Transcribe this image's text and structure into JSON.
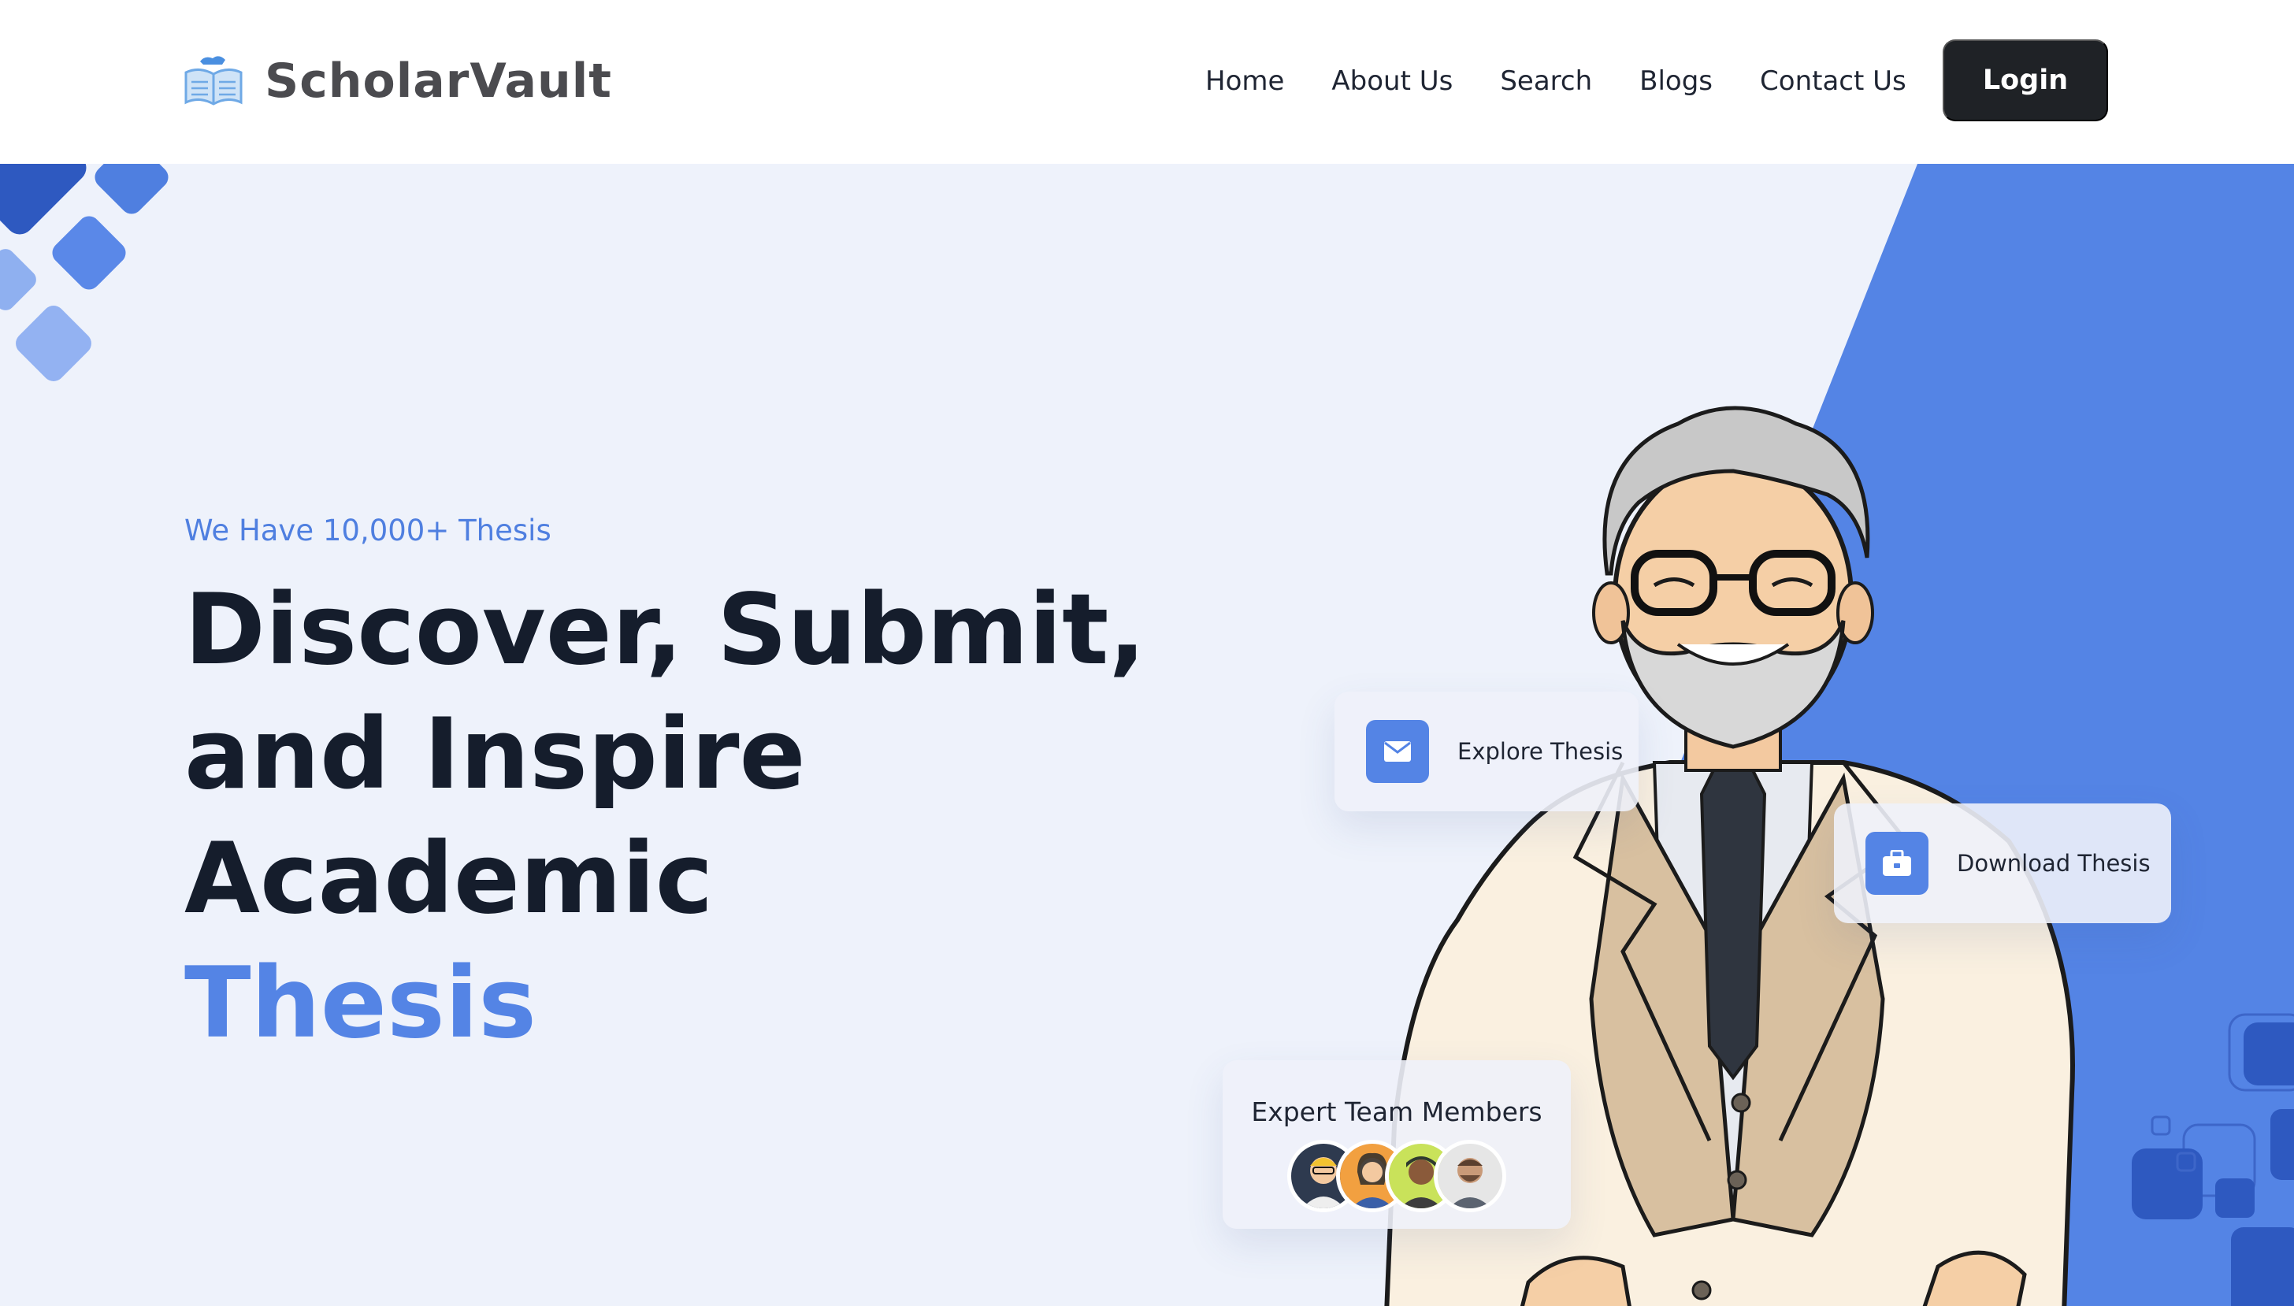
{
  "header": {
    "brand_name": "ScholarVault",
    "nav": [
      "Home",
      "About Us",
      "Search",
      "Blogs",
      "Contact Us"
    ],
    "login_label": "Login"
  },
  "hero": {
    "tagline": "We Have 10,000+ Thesis",
    "headline_lines": [
      "Discover, Submit,",
      "and Inspire",
      "Academic"
    ],
    "headline_accent": "Thesis"
  },
  "cards": {
    "explore": {
      "label": "Explore Thesis",
      "icon": "envelope-icon"
    },
    "download": {
      "label": "Download Thesis",
      "icon": "briefcase-icon"
    },
    "team": {
      "title": "Expert Team Members",
      "avatar_count": 4
    }
  },
  "colors": {
    "accent": "#5484e5",
    "dark": "#1f2226",
    "background": "#eef2fb",
    "panel": "#5484e5"
  }
}
